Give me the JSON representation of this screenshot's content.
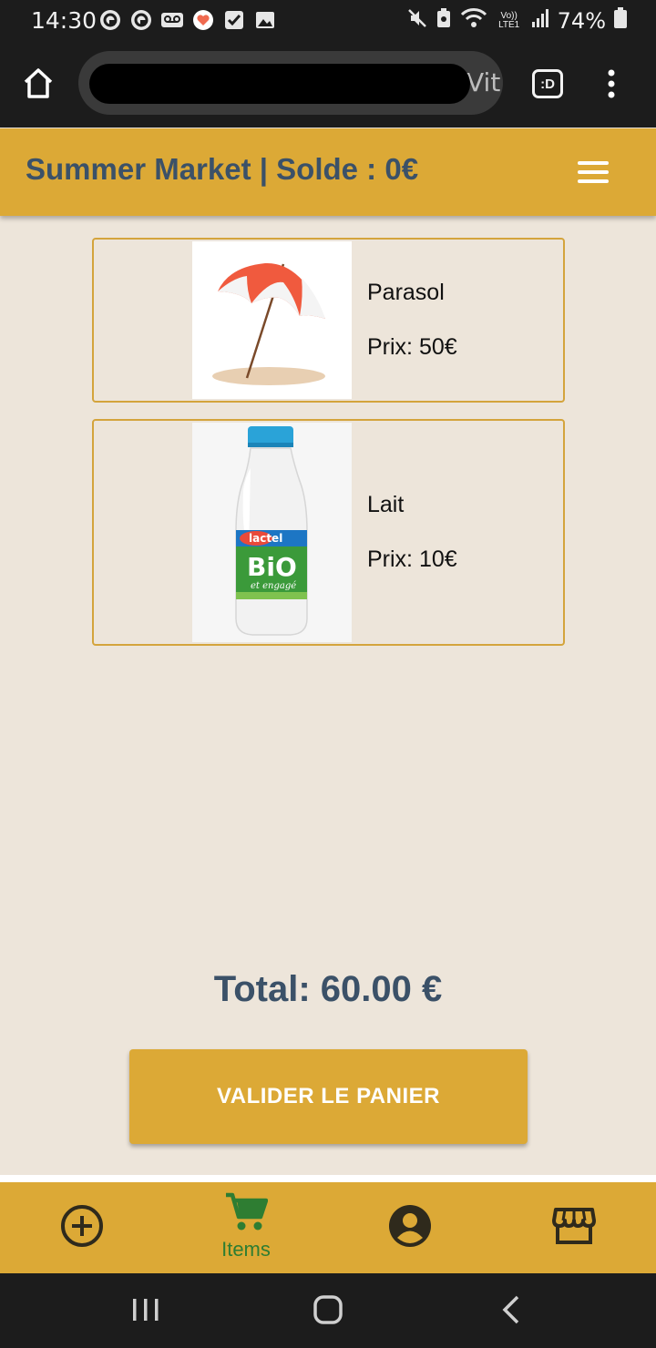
{
  "status_bar": {
    "time": "14:30",
    "battery": "74%",
    "network": "Vo)) LTE1"
  },
  "browser": {
    "url_visible": "Vit",
    "tabs_label": ":D"
  },
  "header": {
    "title": "Summer Market | Solde : 0€"
  },
  "cart": {
    "items": [
      {
        "name": "Parasol",
        "price": "Prix: 50€",
        "image": "beach-umbrella"
      },
      {
        "name": "Lait",
        "price": "Prix: 10€",
        "image": "milk-bottle"
      }
    ],
    "total": "Total: 60.00 €",
    "validate_label": "VALIDER LE PANIER"
  },
  "milk_label": {
    "brand": "lactel",
    "line1": "BiO",
    "line2": "et engagé"
  },
  "bottom_nav": {
    "items": [
      {
        "icon": "add-circle-icon",
        "label": ""
      },
      {
        "icon": "cart-icon",
        "label": "Items"
      },
      {
        "icon": "account-icon",
        "label": ""
      },
      {
        "icon": "store-icon",
        "label": ""
      }
    ]
  },
  "colors": {
    "accent": "#dca936",
    "title_text": "#3b5168",
    "background": "#ede5da",
    "active_nav": "#2e7d32"
  }
}
